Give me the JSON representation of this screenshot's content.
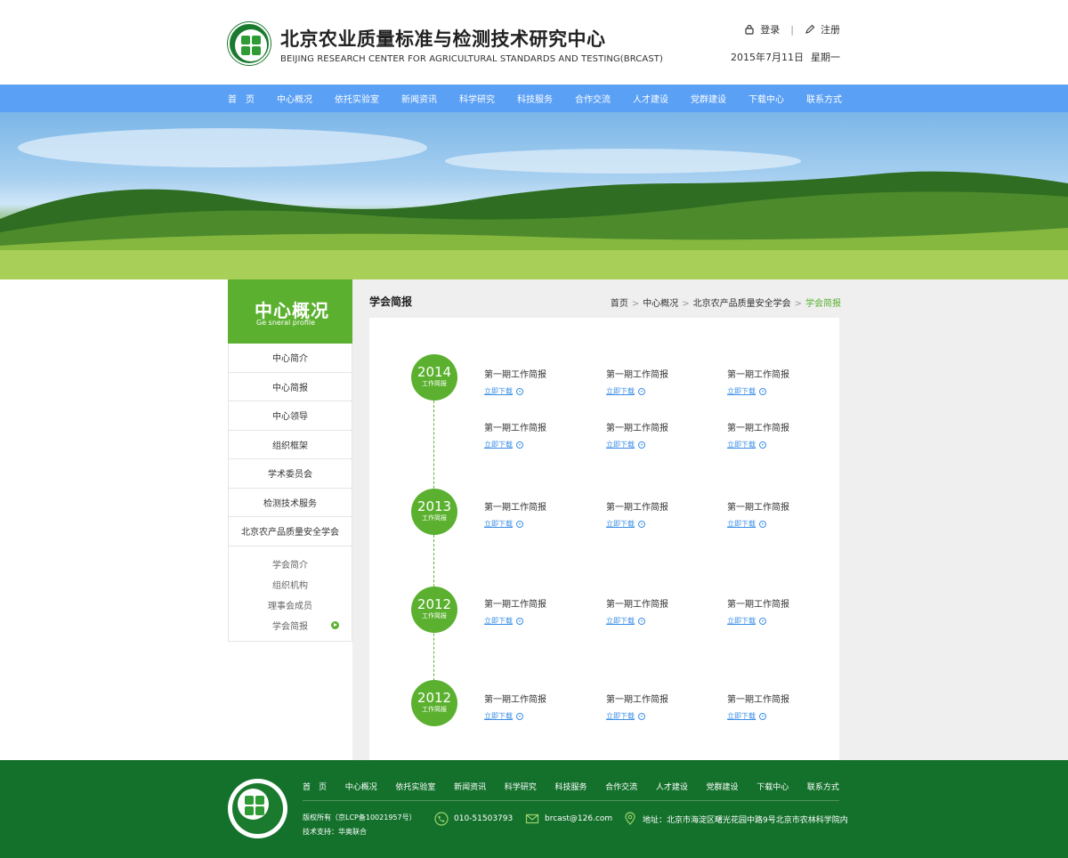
{
  "header": {
    "brand_cn": "北京农业质量标准与检测技术研究中心",
    "brand_en": "BEIJING RESEARCH CENTER FOR AGRICULTURAL STANDARDS AND TESTING(BRCAST)",
    "login": "登录",
    "register": "注册",
    "separator": "|",
    "date": "2015年7月11日",
    "weekday": "星期一"
  },
  "nav": [
    "首　页",
    "中心概况",
    "依托实验室",
    "新闻资讯",
    "科学研究",
    "科技服务",
    "合作交流",
    "人才建设",
    "党群建设",
    "下载中心",
    "联系方式"
  ],
  "sidebar": {
    "title": "中心概况",
    "subtitle": "Ge sneral profile",
    "items": [
      "中心简介",
      "中心简报",
      "中心领导",
      "组织框架",
      "学术委员会",
      "检测技术服务",
      "北京农产品质量安全学会"
    ],
    "sub_items": [
      "学会简介",
      "组织机构",
      "理事会成员",
      "学会简报"
    ]
  },
  "main": {
    "title": "学会简报",
    "breadcrumb": [
      "首页",
      "中心概况",
      "北京农产品质量安全学会",
      "学会简报"
    ],
    "breadcrumb_sep": ">",
    "years": [
      {
        "year": "2014",
        "label": "工作简报"
      },
      {
        "year": "2013",
        "label": "工作简报"
      },
      {
        "year": "2012",
        "label": "工作简报"
      },
      {
        "year": "2012",
        "label": "工作简报"
      }
    ],
    "report_name": "第一期工作简报",
    "download_label": "立即下载"
  },
  "footer": {
    "nav": [
      "首　页",
      "中心概况",
      "依托实验室",
      "新闻资讯",
      "科学研究",
      "科技服务",
      "合作交流",
      "人才建设",
      "党群建设",
      "下载中心",
      "联系方式"
    ],
    "copyright": "版权所有（京LCP备10021957号）",
    "support": "技术支持：华奥联合",
    "phone": "010-51503793",
    "email": "brcast@126.com",
    "address": "地址：北京市海淀区曙光花园中路9号北京市农林科学院内"
  },
  "colors": {
    "accent_green": "#5bb12f",
    "nav_blue": "#5aa0f5",
    "footer_green": "#14712c",
    "link_blue": "#3a8ee6"
  }
}
